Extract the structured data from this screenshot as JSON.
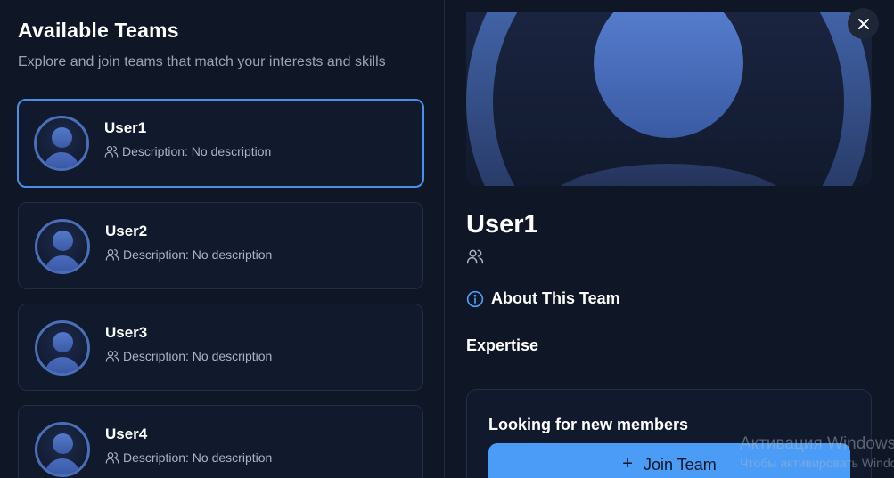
{
  "list": {
    "title": "Available Teams",
    "subtitle": "Explore and join teams that match your interests and skills",
    "teams": [
      {
        "name": "User1",
        "description": "Description: No description",
        "selected": true
      },
      {
        "name": "User2",
        "description": "Description: No description",
        "selected": false
      },
      {
        "name": "User3",
        "description": "Description: No description",
        "selected": false
      },
      {
        "name": "User4",
        "description": "Description: No description",
        "selected": false
      }
    ]
  },
  "detail": {
    "name": "User1",
    "about_label": "About This Team",
    "expertise_label": "Expertise",
    "recruit_title": "Looking for new members",
    "join_label": "Join Team",
    "close_icon": "close-icon"
  },
  "watermark": {
    "line1": "Активация Windows",
    "line2": "Чтобы активировать Windows"
  },
  "colors": {
    "background": "#0f1626",
    "accent": "#4a9cf6",
    "selected_border": "#4a8fe7"
  }
}
